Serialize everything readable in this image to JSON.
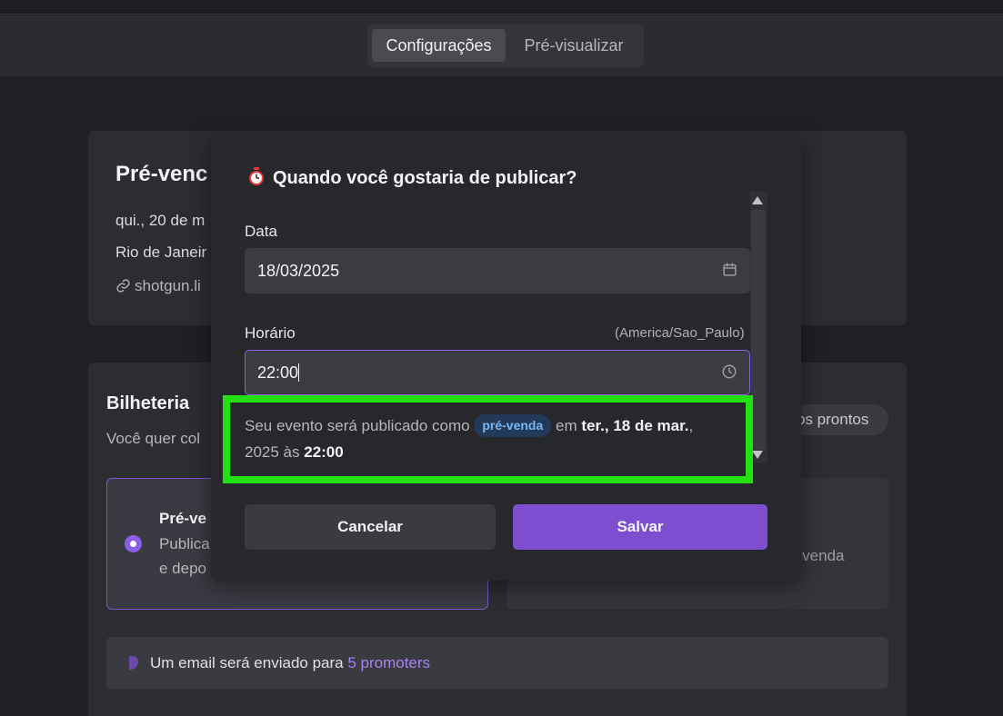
{
  "tabs": {
    "active": "Configurações",
    "inactive": "Pré-visualizar"
  },
  "event": {
    "title": "Pré-venc",
    "date_line": "qui., 20 de m",
    "location": "Rio de Janeir",
    "link": "shotgun.li"
  },
  "ticketing": {
    "title": "Bilheteria",
    "subtitle": "Você quer col",
    "right_pill": "os prontos",
    "option_selected": {
      "title": "Pré-ve",
      "desc_line1": "Publica",
      "desc_line2": "e depo"
    },
    "option_other_desc": "a venda"
  },
  "email_notice": {
    "text": "Um email será enviado para ",
    "link": "5 promoters"
  },
  "modal": {
    "title": "Quando você gostaria de publicar?",
    "date_label": "Data",
    "date_value": "18/03/2025",
    "time_label": "Horário",
    "timezone": "(America/Sao_Paulo)",
    "time_value": "22:00",
    "message": {
      "prefix": "Seu evento será publicado como",
      "badge": "pré-venda",
      "middle": "em",
      "date": "ter., 18 de mar.",
      "line2_prefix": "2025 às",
      "time": "22:00"
    },
    "cancel_label": "Cancelar",
    "save_label": "Salvar"
  },
  "colors": {
    "accent": "#7d4fd0",
    "link": "#a583f2",
    "highlight_border": "#22e011",
    "badge_bg": "#23395a",
    "badge_text": "#7ab8f5"
  }
}
